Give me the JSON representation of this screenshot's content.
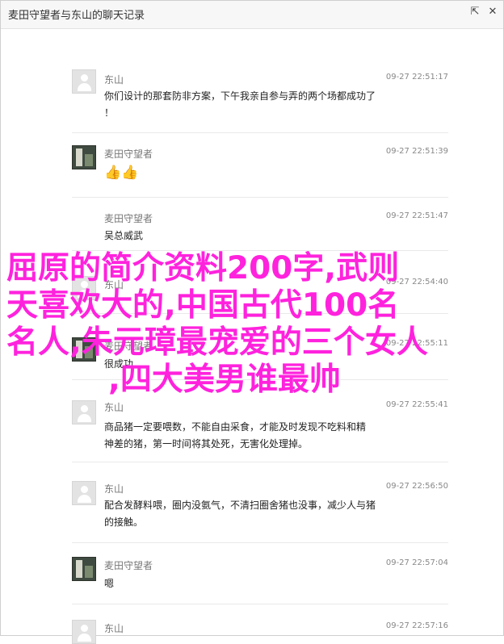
{
  "window": {
    "title": "麦田守望者与东山的聊天记录",
    "export_icon": "export-icon",
    "close_icon": "close-icon"
  },
  "messages": [
    {
      "sender": "东山",
      "time": "09-27 22:51:17",
      "avatar": "default-avatar",
      "text": "你们设计的那套防非方案，下午我亲自参与弄的两个场都成功了\n！"
    },
    {
      "sender": "麦田守望者",
      "time": "09-27 22:51:39",
      "avatar": "photo-avatar",
      "text": "👍👍"
    },
    {
      "sender": "麦田守望者",
      "time": "09-27 22:51:47",
      "avatar": "none",
      "text": "吴总威武"
    },
    {
      "sender": "东山",
      "time": "09-27 22:54:40",
      "avatar": "default-avatar",
      "text": ""
    },
    {
      "sender": "麦田守望者",
      "time": "09-27 22:55:11",
      "avatar": "photo-avatar",
      "text": "很成功"
    },
    {
      "sender": "东山",
      "time": "09-27 22:55:41",
      "avatar": "default-avatar",
      "text": "商品猪一定要喂数，不能自由采食，才能及时发现不吃料和精\n神差的猪，第一时间将其处死，无害化处理掉。"
    },
    {
      "sender": "东山",
      "time": "09-27 22:56:50",
      "avatar": "default-avatar",
      "text": "配合发酵料喂，圈内没氨气，不清扫圈舍猪也没事，减少人与猪\n的接触。"
    },
    {
      "sender": "麦田守望者",
      "time": "09-27 22:57:04",
      "avatar": "photo-avatar",
      "text": "嗯"
    },
    {
      "sender": "东山",
      "time": "09-27 22:57:16",
      "avatar": "default-avatar",
      "text": ""
    }
  ],
  "overlay": {
    "lines": [
      "屈原的简介资料200字,武则",
      "天喜欢大的,中国古代100名",
      "名人,朱元璋最宠爱的三个女人",
      ",四大美男谁最帅"
    ],
    "color": "#ff22dd"
  }
}
